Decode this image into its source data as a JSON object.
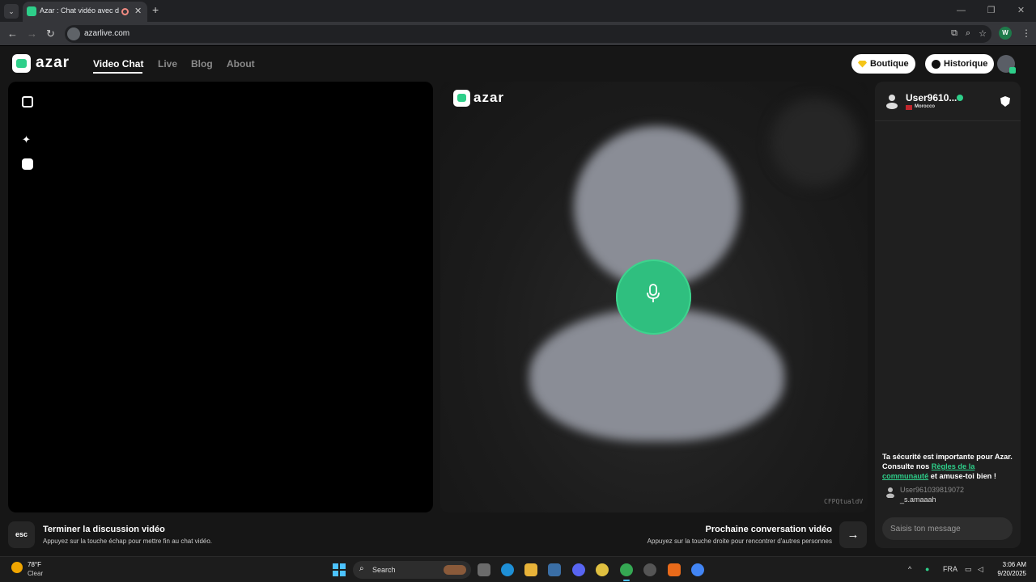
{
  "browser": {
    "tab_title": "Azar : Chat vidéo avec de n",
    "url": "azarlive.com"
  },
  "header": {
    "logo": "azar",
    "nav": [
      "Video Chat",
      "Live",
      "Blog",
      "About"
    ],
    "boutique_label": "Boutique",
    "historique_label": "Historique"
  },
  "video": {
    "watermark": "azar",
    "session_code": "CFPQtualdV"
  },
  "chat": {
    "peer_name": "User9610...",
    "peer_country": "Morocco",
    "safety_pre": "Ta sécurité est importante pour Azar. Consulte nos ",
    "safety_link": "Règles de la communauté",
    "safety_post": " et amuse-toi bien !",
    "system_user": "User961039819072",
    "system_text": "_s.amaaah",
    "input_placeholder": "Saisis ton message"
  },
  "footer": {
    "esc_key": "esc",
    "end_title": "Terminer la discussion vidéo",
    "end_sub": "Appuyez sur la touche échap pour mettre fin au chat vidéo.",
    "next_title": "Prochaine conversation vidéo",
    "next_sub": "Appuyez sur la touche droite pour rencontrer d'autres personnes",
    "next_arrow": "→"
  },
  "taskbar": {
    "weather_temp": "78°F",
    "weather_desc": "Clear",
    "search_label": "Search",
    "lang": "FRA",
    "time": "3:06 AM",
    "date": "9/20/2025"
  },
  "colors": {
    "accent": "#2ecf8a",
    "mic": "#2fbf7f",
    "background": "#161616"
  }
}
